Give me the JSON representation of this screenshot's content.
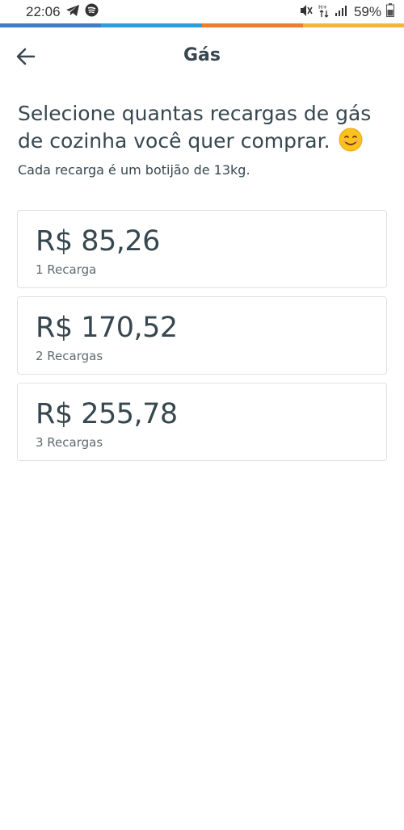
{
  "status_bar": {
    "time": "22:06",
    "battery_percent": "59%",
    "left_icons": [
      "telegram-icon",
      "spotify-icon"
    ],
    "right_icons": [
      "mute-icon",
      "data-arrows-icon",
      "signal-icon",
      "battery-icon"
    ]
  },
  "stripe_colors": [
    "#3d7fc4",
    "#2a9fe0",
    "#f07b2c",
    "#f5b43a"
  ],
  "toolbar": {
    "title": "Gás"
  },
  "content": {
    "heading": "Selecione quantas recargas de gás de cozinha você quer comprar.",
    "emoji": "smiling-face-emoji",
    "subheading": "Cada recarga é um botijão de 13kg."
  },
  "options": [
    {
      "price": "R$ 85,26",
      "label": "1 Recarga"
    },
    {
      "price": "R$ 170,52",
      "label": "2 Recargas"
    },
    {
      "price": "R$ 255,78",
      "label": "3 Recargas"
    }
  ]
}
